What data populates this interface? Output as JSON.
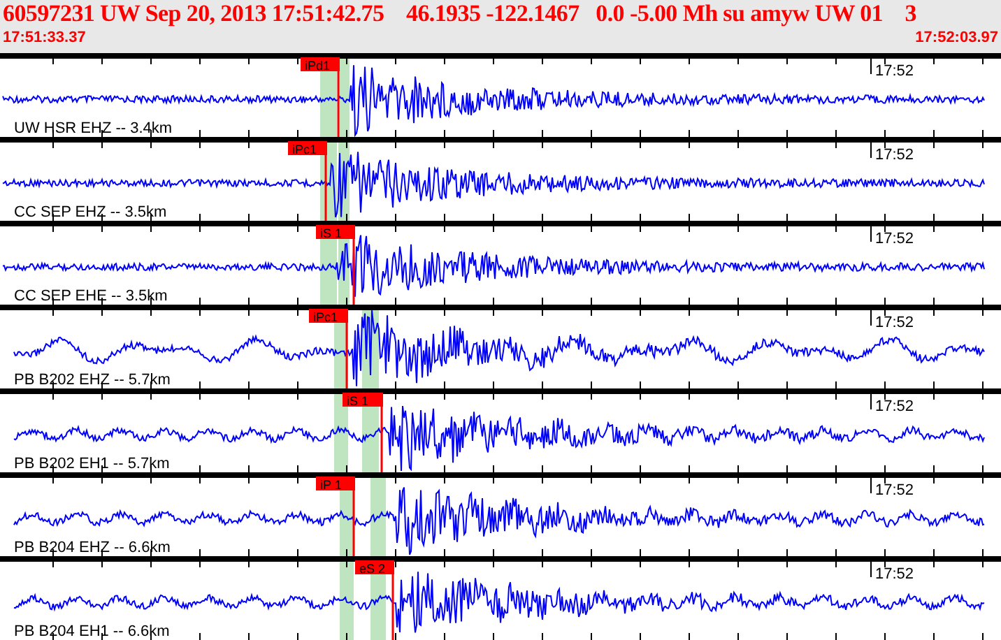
{
  "header": {
    "title": "60597231 UW Sep 20, 2013 17:51:42.75    46.1935 -122.1467   0.0 -5.00 Mh su amyw UW 01    3",
    "start_time": "17:51:33.37",
    "end_time": "17:52:03.97"
  },
  "traces": [
    {
      "label": "UW HSR EHZ -- 3.4km",
      "time_label": "17:52",
      "pick": "iPd1"
    },
    {
      "label": "CC SEP EHZ -- 3.5km",
      "time_label": "17:52",
      "pick": "iPc1"
    },
    {
      "label": "CC SEP EHE -- 3.5km",
      "time_label": "17:52",
      "pick": "iS 1"
    },
    {
      "label": "PB B202 EHZ -- 5.7km",
      "time_label": "17:52",
      "pick": "iPc1"
    },
    {
      "label": "PB B202 EH1 -- 5.7km",
      "time_label": "17:52",
      "pick": "iS 1"
    },
    {
      "label": "PB B204 EHZ -- 6.6km",
      "time_label": "17:52",
      "pick": "iP 1"
    },
    {
      "label": "PB B204 EH1 -- 6.6km",
      "time_label": "17:52",
      "pick": "eS 2"
    }
  ]
}
